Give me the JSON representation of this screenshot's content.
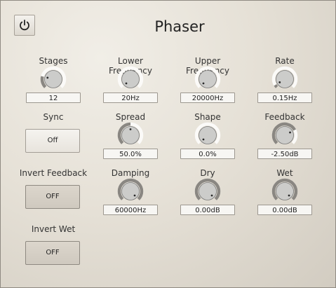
{
  "title": "Phaser",
  "power": {
    "icon": "power-icon"
  },
  "left": {
    "stages": {
      "label": "Stages",
      "value": "12",
      "level": 0.22
    },
    "sync": {
      "label": "Sync",
      "value": "Off"
    },
    "invert_feedback": {
      "label": "Invert Feedback",
      "value": "OFF"
    },
    "invert_wet": {
      "label": "Invert Wet",
      "value": "OFF"
    }
  },
  "knobs": [
    {
      "id": "lower-frequency",
      "label": "Lower Frequency",
      "value": "20Hz",
      "level": 0.0
    },
    {
      "id": "upper-frequency",
      "label": "Upper Frequency",
      "value": "20000Hz",
      "level": 0.0
    },
    {
      "id": "rate",
      "label": "Rate",
      "value": "0.15Hz",
      "level": 0.05
    },
    {
      "id": "spread",
      "label": "Spread",
      "value": "50.0%",
      "level": 0.5
    },
    {
      "id": "shape",
      "label": "Shape",
      "value": "0.0%",
      "level": 0.0
    },
    {
      "id": "feedback",
      "label": "Feedback",
      "value": "-2.50dB",
      "level": 0.73
    },
    {
      "id": "damping",
      "label": "Damping",
      "value": "60000Hz",
      "level": 1.0
    },
    {
      "id": "dry",
      "label": "Dry",
      "value": "0.00dB",
      "level": 1.0
    },
    {
      "id": "wet",
      "label": "Wet",
      "value": "0.00dB",
      "level": 1.0
    }
  ],
  "colors": {
    "arc_active": "#8a8782",
    "arc_track": "#fbfaf8",
    "knob_face": "#ccccca",
    "indicator": "#2a2a2a"
  }
}
